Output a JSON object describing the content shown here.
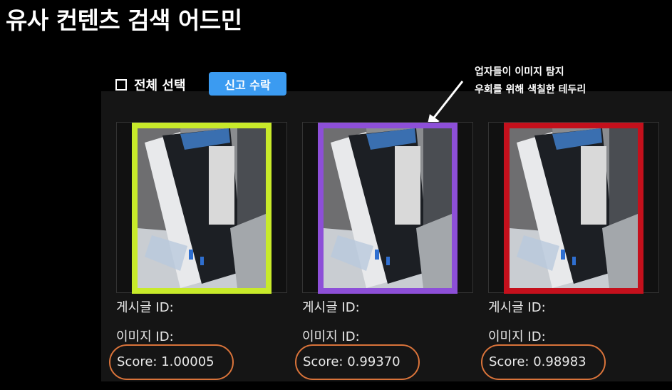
{
  "page_title": "유사 컨텐츠 검색 어드민",
  "toolbar": {
    "select_all_label": "전체 선택",
    "report_accept_label": "신고 수락"
  },
  "annotation": {
    "line1": "업자들이 이미지 탐지",
    "line2": "우회를 위해 색칠한 테두리"
  },
  "cards": [
    {
      "post_id_label": "게시글 ID:",
      "image_id_label": "이미지 ID:",
      "score_label": "Score: 1.00005",
      "border_color": "#c8ea2a"
    },
    {
      "post_id_label": "게시글 ID:",
      "image_id_label": "이미지 ID:",
      "score_label": "Score: 0.99370",
      "border_color": "#8d4fd8"
    },
    {
      "post_id_label": "게시글 ID:",
      "image_id_label": "이미지 ID:",
      "score_label": "Score: 0.98983",
      "border_color": "#c4101c"
    }
  ],
  "colors": {
    "background": "#000000",
    "panel": "#151515",
    "button": "#3b9bf1",
    "score_highlight": "#d9733a"
  }
}
